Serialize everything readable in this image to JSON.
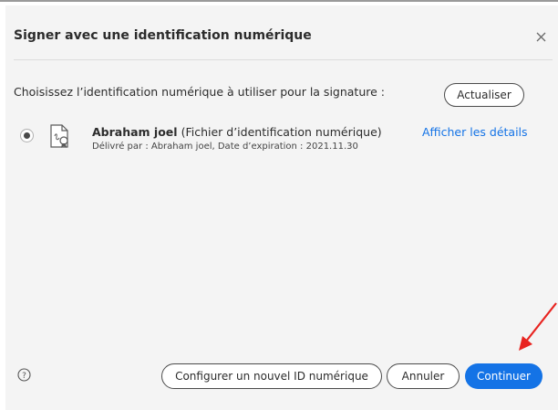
{
  "dialog": {
    "title": "Signer avec une identification numérique",
    "close_icon": "close-icon",
    "instruction": "Choisissez l’identification numérique à utiliser pour la signature :",
    "refresh_label": "Actualiser"
  },
  "certificate": {
    "selected": true,
    "name": "Abraham joel",
    "type": "(Fichier d’identification numérique)",
    "detail": "Délivré par : Abraham joel, Date d’expiration : 2021.11.30",
    "show_details_label": "Afficher les détails",
    "icon": "digital-id-certificate-icon"
  },
  "footer": {
    "help_icon": "help-icon",
    "configure_label": "Configurer un nouvel ID numérique",
    "cancel_label": "Annuler",
    "continue_label": "Continuer"
  },
  "annotation": {
    "arrow_icon": "red-arrow-icon",
    "arrow_color": "#e8231f"
  },
  "colors": {
    "accent": "#1473e6",
    "dialog_background": "#f4f4f4"
  }
}
